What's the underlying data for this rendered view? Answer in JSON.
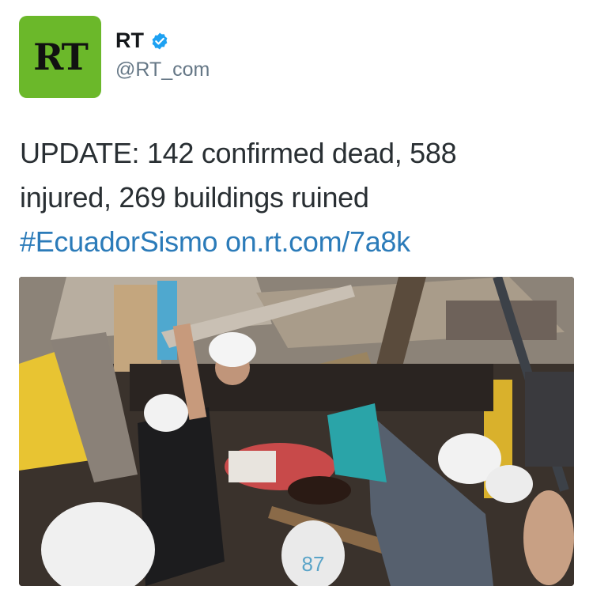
{
  "profile": {
    "avatar_text": "RT",
    "avatar_color": "#6bb82a",
    "display_name": "RT",
    "handle": "@RT_com",
    "verified": true,
    "verified_icon": "verified-badge-icon"
  },
  "tweet": {
    "line1": "UPDATE: 142 confirmed dead, 588",
    "line2": "injured, 269 buildings ruined",
    "hashtag": "#EcuadorSismo",
    "link": "on.rt.com/7a8k",
    "link_color": "#2b7bb9"
  },
  "media": {
    "helmet_number": "87"
  }
}
